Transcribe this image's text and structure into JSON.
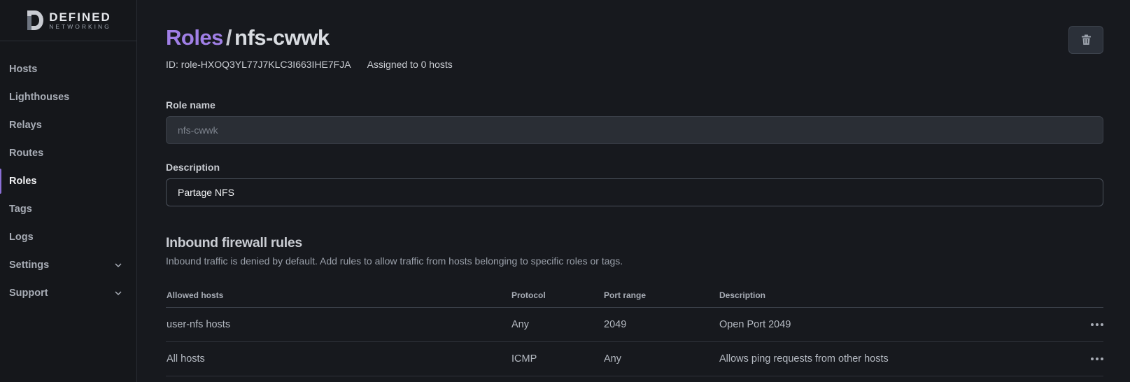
{
  "brand": {
    "word": "DEFINED",
    "sub": "NETWORKING"
  },
  "sidebar": {
    "items": [
      {
        "label": "Hosts"
      },
      {
        "label": "Lighthouses"
      },
      {
        "label": "Relays"
      },
      {
        "label": "Routes"
      },
      {
        "label": "Roles"
      },
      {
        "label": "Tags"
      },
      {
        "label": "Logs"
      },
      {
        "label": "Settings"
      },
      {
        "label": "Support"
      }
    ]
  },
  "header": {
    "crumb": "Roles",
    "separator": "/",
    "name": "nfs-cwwk",
    "id_text": "ID: role-HXOQ3YL77J7KLC3I663IHE7FJA",
    "assigned_text": "Assigned to 0 hosts"
  },
  "form": {
    "role_name_label": "Role name",
    "role_name_value": "nfs-cwwk",
    "description_label": "Description",
    "description_value": "Partage NFS"
  },
  "firewall": {
    "title": "Inbound firewall rules",
    "description": "Inbound traffic is denied by default. Add rules to allow traffic from hosts belonging to specific roles or tags.",
    "columns": [
      "Allowed hosts",
      "Protocol",
      "Port range",
      "Description"
    ],
    "rows": [
      {
        "hosts": "user-nfs hosts",
        "protocol": "Any",
        "port": "2049",
        "description": "Open Port 2049"
      },
      {
        "hosts": "All hosts",
        "protocol": "ICMP",
        "port": "Any",
        "description": "Allows ping requests from other hosts"
      }
    ]
  },
  "colors": {
    "accent": "#a07fe6",
    "background": "#17191e"
  }
}
